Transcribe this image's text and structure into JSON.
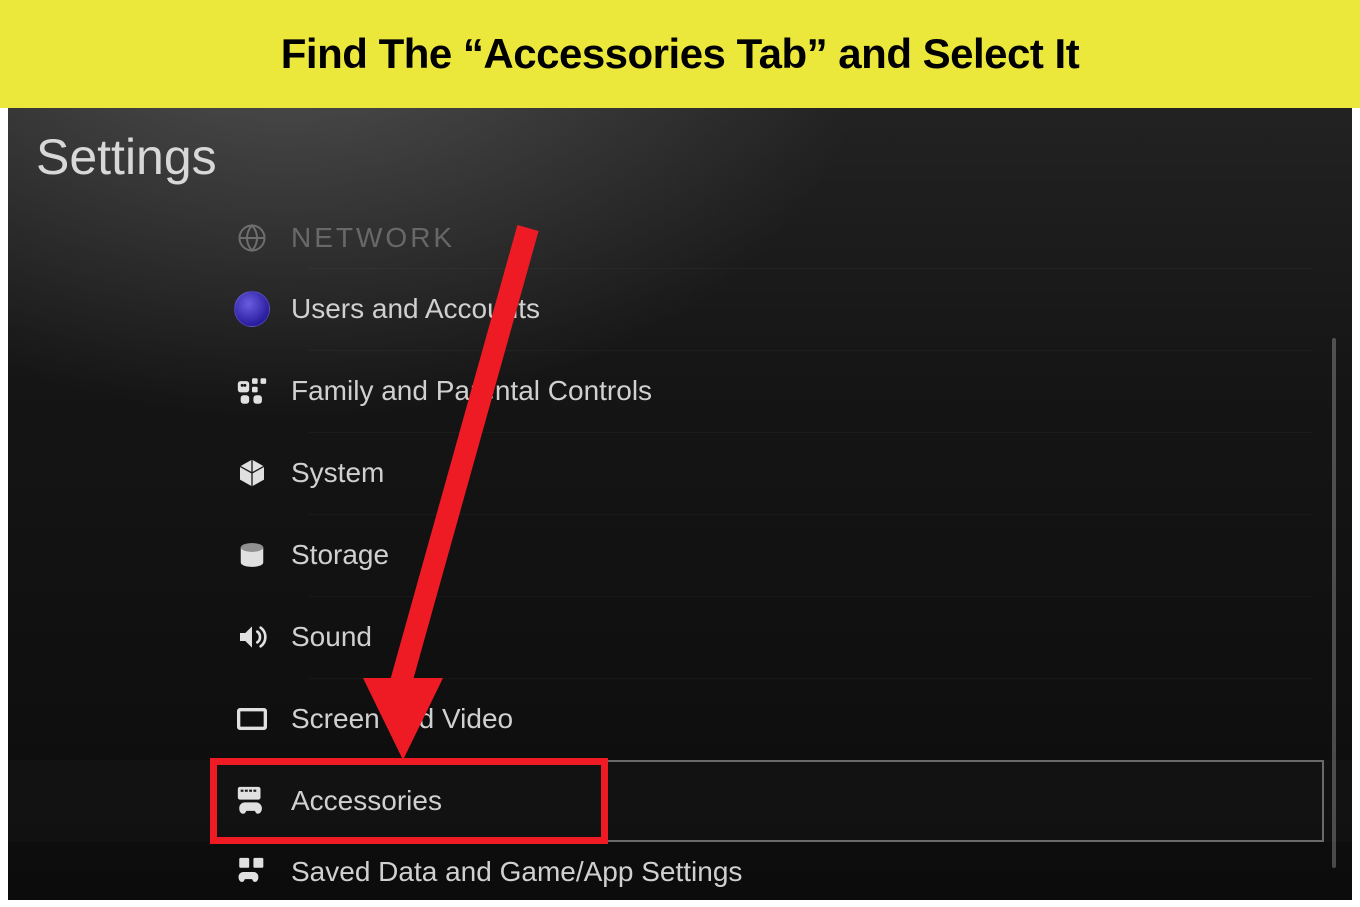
{
  "banner": {
    "text": "Find The “Accessories Tab” and Select It"
  },
  "page_title": "Settings",
  "menu": {
    "items": [
      {
        "id": "network",
        "label": "NETWORK",
        "icon": "globe-icon",
        "faded": true
      },
      {
        "id": "users",
        "label": "Users and Accounts",
        "icon": "avatar-icon"
      },
      {
        "id": "family",
        "label": "Family and Parental Controls",
        "icon": "family-icon"
      },
      {
        "id": "system",
        "label": "System",
        "icon": "cube-icon"
      },
      {
        "id": "storage",
        "label": "Storage",
        "icon": "storage-icon"
      },
      {
        "id": "sound",
        "label": "Sound",
        "icon": "speaker-icon"
      },
      {
        "id": "screen",
        "label": "Screen and Video",
        "icon": "display-icon"
      },
      {
        "id": "accessories",
        "label": "Accessories",
        "icon": "accessories-icon",
        "selected": true,
        "highlighted": true
      },
      {
        "id": "saved",
        "label": "Saved Data and Game/App Settings",
        "icon": "saved-data-icon"
      }
    ]
  },
  "annotation": {
    "arrow_color": "#ee1b24",
    "highlight_color": "#ee1b24"
  }
}
